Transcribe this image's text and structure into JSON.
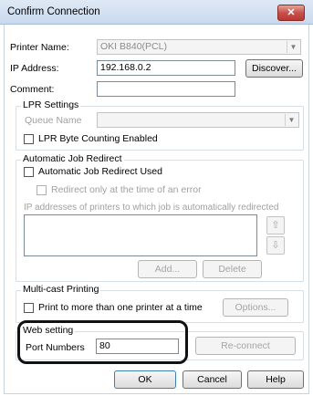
{
  "window": {
    "title": "Confirm Connection",
    "close_glyph": "✕"
  },
  "printer": {
    "label": "Printer Name:",
    "value": "OKI B840(PCL)"
  },
  "ip": {
    "label": "IP Address:",
    "value": "192.168.0.2",
    "discover_label": "Discover..."
  },
  "comment": {
    "label": "Comment:",
    "value": ""
  },
  "lpr": {
    "group_label": "LPR Settings",
    "queue_label": "Queue Name",
    "queue_value": "",
    "byte_counting_label": "LPR Byte Counting Enabled",
    "byte_counting_checked": false
  },
  "redirect": {
    "group_label": "Automatic Job Redirect",
    "used_label": "Automatic Job Redirect Used",
    "used_checked": false,
    "error_only_label": "Redirect only at the time of an error",
    "error_only_checked": false,
    "list_label": "IP addresses of printers to which job is automatically redirected",
    "list_items": [],
    "up_icon": "up-arrow-icon",
    "down_icon": "down-arrow-icon",
    "add_label": "Add...",
    "delete_label": "Delete"
  },
  "multicast": {
    "group_label": "Multi-cast Printing",
    "print_label": "Print to more than one printer at a time",
    "print_checked": false,
    "options_label": "Options..."
  },
  "web": {
    "group_label": "Web setting",
    "port_label": "Port Numbers",
    "port_value": "80",
    "reconnect_label": "Re-connect"
  },
  "footer": {
    "ok_label": "OK",
    "cancel_label": "Cancel",
    "help_label": "Help"
  },
  "colors": {
    "titlebar": "#c9d9ee",
    "close_button": "#c75050",
    "highlight_border": "#111111"
  }
}
